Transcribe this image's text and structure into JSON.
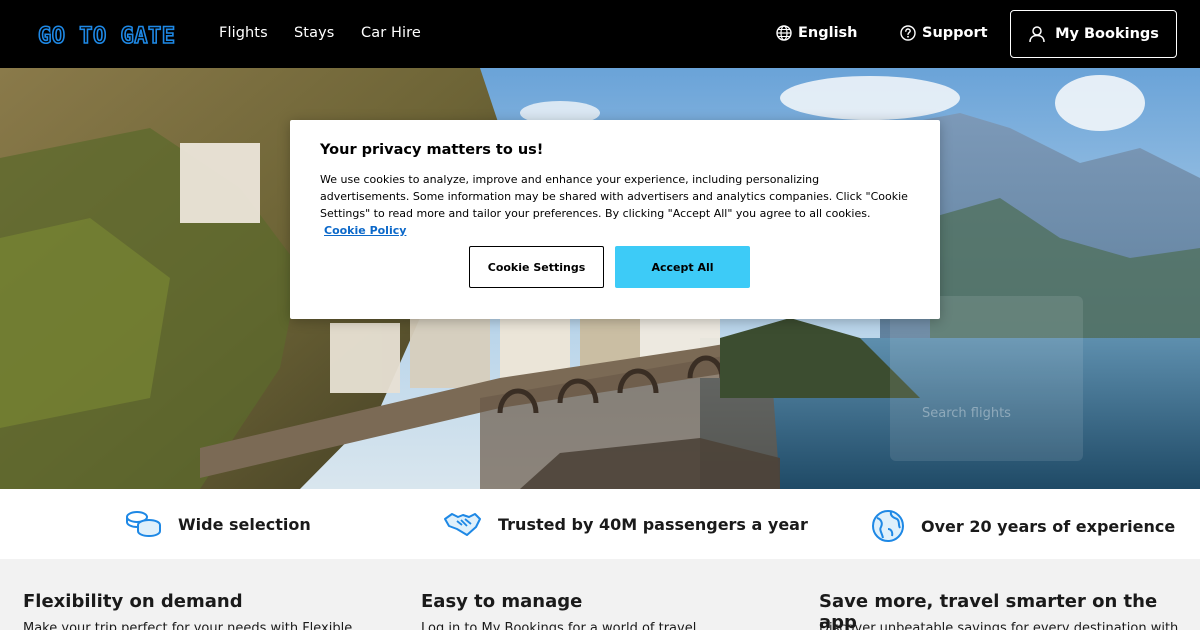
{
  "header": {
    "logo_text": "GO TO GATE",
    "nav": [
      "Flights",
      "Stays",
      "Car Hire"
    ],
    "language_label": "English",
    "support_label": "Support",
    "bookings_label": "My Bookings"
  },
  "hero": {
    "search_placeholder": "Search flights"
  },
  "cookie_modal": {
    "title": "Your privacy matters to us!",
    "body": "We use cookies to analyze, improve and enhance your experience, including personalizing advertisements. Some information may be shared with advertisers and analytics companies. Click \"Cookie Settings\" to read more and tailor your preferences. By clicking \"Accept All\" you agree to all cookies.",
    "policy_link": "Cookie Policy",
    "settings_button": "Cookie Settings",
    "accept_button": "Accept All"
  },
  "features": [
    {
      "label": "Wide selection",
      "icon": "coins-icon"
    },
    {
      "label": "Trusted by 40M passengers a year",
      "icon": "handshake-icon"
    },
    {
      "label": "Over 20 years of experience",
      "icon": "globe-icon"
    }
  ],
  "cards": [
    {
      "title": "Flexibility on demand",
      "text": "Make your trip perfect for your needs with Flexible"
    },
    {
      "title": "Easy to manage",
      "text": "Log in to My Bookings for a world of travel"
    },
    {
      "title": "Save more, travel smarter on the app",
      "text": "Discover unbeatable savings for every destination with"
    }
  ],
  "colors": {
    "header_bg": "#000000",
    "accent_blue": "#1e88e5",
    "accept_button": "#3dcbf7",
    "link": "#0b68c9",
    "lower_bg": "#f2f2f2"
  }
}
